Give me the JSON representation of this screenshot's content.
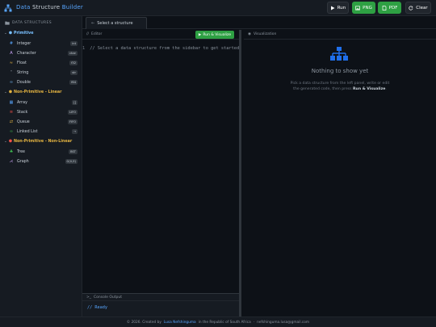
{
  "app": {
    "title_part1": "Data",
    "title_part2": "Structure",
    "title_part3": "Builder",
    "accent": "#58a6ff",
    "success": "#2ea043"
  },
  "toolbar": {
    "run_label": "Run",
    "png_label": "PNG",
    "pdf_label": "PDF",
    "clear_label": "Clear"
  },
  "sidebar": {
    "header": "DATA STRUCTURES",
    "categories": [
      {
        "label": "Primitive",
        "icon": "chip-icon",
        "items": [
          {
            "label": "Integer",
            "badge": "int",
            "icon": "hash-icon"
          },
          {
            "label": "Character",
            "badge": "char",
            "icon": "letter-a-icon"
          },
          {
            "label": "Float",
            "badge": "f32",
            "icon": "wave-icon"
          },
          {
            "label": "String",
            "badge": "str",
            "icon": "quote-icon"
          },
          {
            "label": "Double",
            "badge": "f64",
            "icon": "infinity-icon"
          }
        ]
      },
      {
        "label": "Non-Primitive - Linear",
        "icon": "chip-icon",
        "items": [
          {
            "label": "Array",
            "badge": "[]",
            "icon": "grid-icon"
          },
          {
            "label": "Stack",
            "badge": "LIFO",
            "icon": "stack-icon"
          },
          {
            "label": "Queue",
            "badge": "FIFO",
            "icon": "queue-icon"
          },
          {
            "label": "Linked List",
            "badge": "→",
            "icon": "link-icon"
          }
        ]
      },
      {
        "label": "Non-Primitive - Non-Linear",
        "icon": "chip-icon",
        "items": [
          {
            "label": "Tree",
            "badge": "BST",
            "icon": "tree-icon"
          },
          {
            "label": "Graph",
            "badge": "G(V,E)",
            "icon": "graph-icon"
          }
        ]
      }
    ]
  },
  "tabs": {
    "active_label": "Select a structure"
  },
  "editor": {
    "header": "Editor",
    "run_visualize_label": "Run & Visualize",
    "line_number": "1",
    "code_line": "// Select a data structure from the sidebar to get started"
  },
  "console": {
    "header": "Console Output",
    "line": "// Ready"
  },
  "visualization": {
    "header": "Visualization",
    "empty_title": "Nothing to show yet",
    "empty_desc_part1": "Pick a data structure from the left panel, write or edit the generated code, then press ",
    "empty_desc_bold": "Run & Visualize",
    "empty_desc_part2": "."
  },
  "footer": {
    "text1": "© 2026. Created by",
    "author": "Lusa Nefshinguma",
    "text2": "in the Republic of South Africa",
    "separator": "·",
    "email": "nefshinguma.lusa@gmail.com"
  }
}
